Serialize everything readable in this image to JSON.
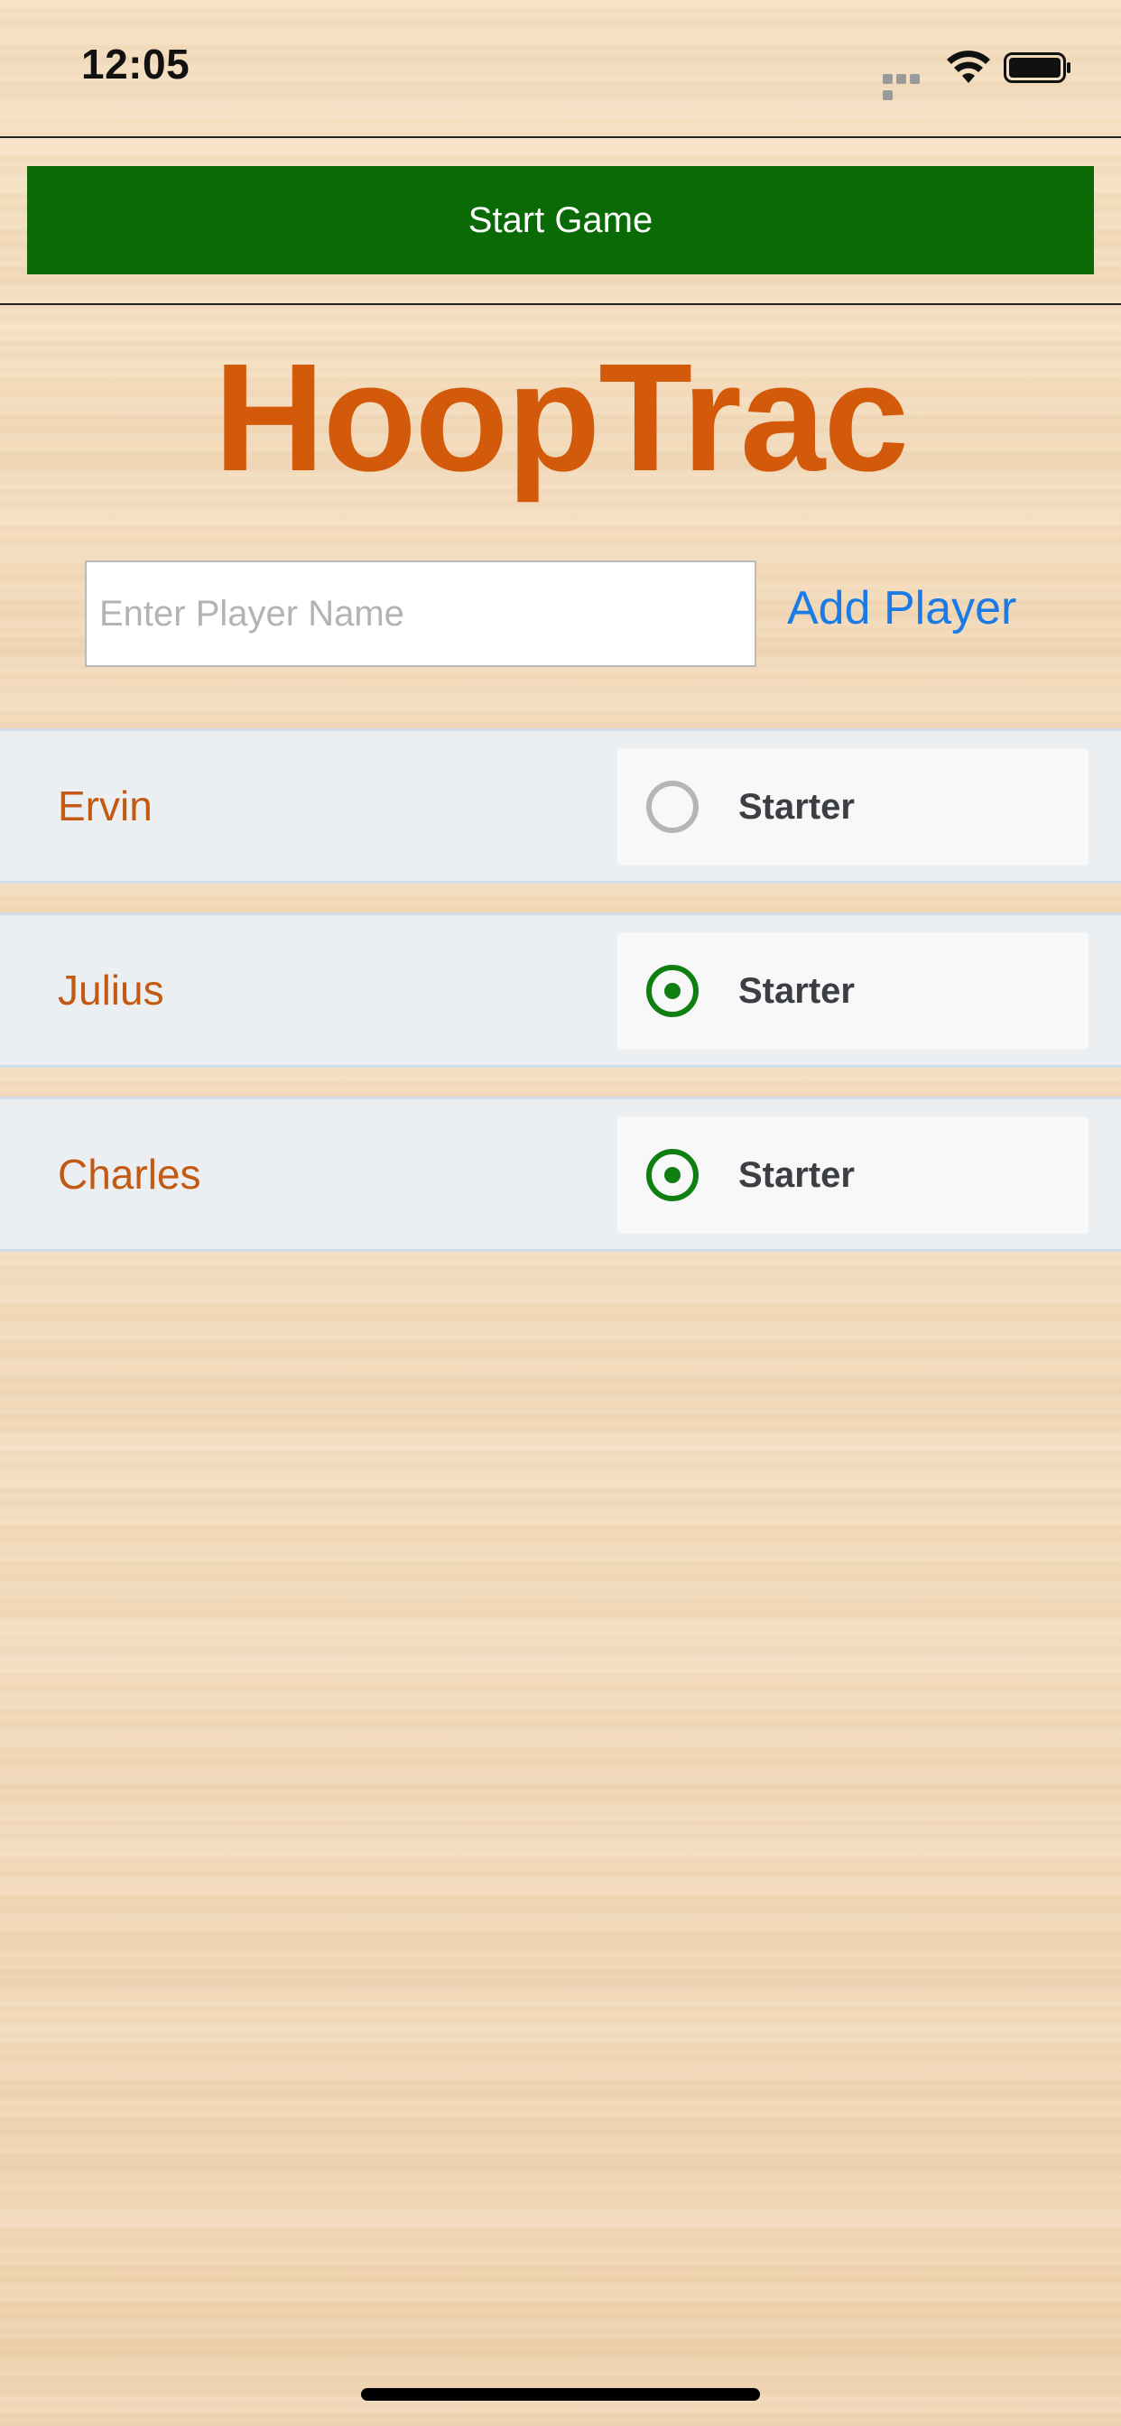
{
  "status_bar": {
    "time": "12:05",
    "icons": [
      "cellular-signal-icon",
      "wifi-icon",
      "battery-icon"
    ]
  },
  "toolbar": {
    "start_game_label": "Start Game",
    "start_game_color": "#0a6a05"
  },
  "app": {
    "title": "HoopTrac",
    "title_color": "#d35a0a"
  },
  "add_player": {
    "input_placeholder": "Enter Player Name",
    "input_value": "",
    "button_label": "Add Player",
    "button_color": "#1a7be6"
  },
  "players": [
    {
      "name": "Ervin",
      "starter_label": "Starter",
      "starter_selected": false
    },
    {
      "name": "Julius",
      "starter_label": "Starter",
      "starter_selected": true
    },
    {
      "name": "Charles",
      "starter_label": "Starter",
      "starter_selected": true
    }
  ],
  "colors": {
    "radio_selected": "#0f7f12",
    "radio_unselected": "#b5b5b5",
    "player_name": "#c25a14"
  }
}
